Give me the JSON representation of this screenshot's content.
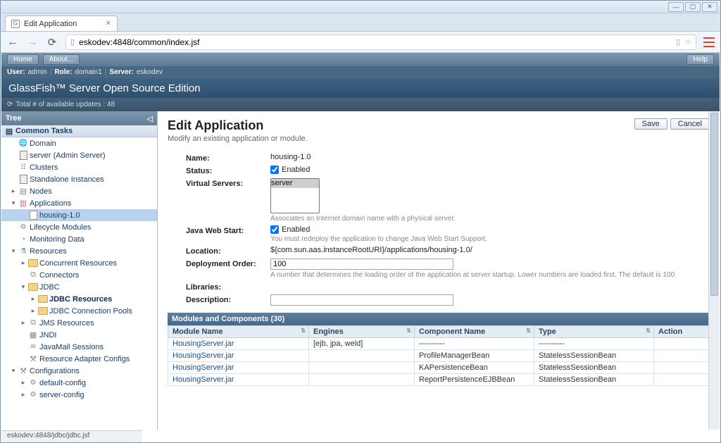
{
  "window": {
    "min": "—",
    "max": "▢",
    "close": "✕"
  },
  "browser": {
    "tab_title": "Edit Application",
    "url": "eskodev:4848/common/index.jsf",
    "status": "eskodev:4848/jdbc/jdbc.jsf"
  },
  "toolbar": {
    "home": "Home",
    "about": "About...",
    "help": "Help"
  },
  "userbar": {
    "user_lbl": "User:",
    "user": "admin",
    "role_lbl": "Role:",
    "role": "domain1",
    "server_lbl": "Server:",
    "server": "eskodev"
  },
  "product_title": "GlassFish™ Server Open Source Edition",
  "updates": {
    "icon": "⟳",
    "text": "Total # of available updates : 48"
  },
  "tree": {
    "header": "Tree",
    "common_tasks": "Common Tasks",
    "items": [
      {
        "ind": 0,
        "exp": "",
        "ico": "ico-globe",
        "txt": "Domain"
      },
      {
        "ind": 0,
        "exp": "",
        "ico": "ico-server",
        "txt": "server (Admin Server)"
      },
      {
        "ind": 0,
        "exp": "",
        "ico": "ico-cluster",
        "txt": "Clusters"
      },
      {
        "ind": 0,
        "exp": "",
        "ico": "ico-server",
        "txt": "Standalone Instances"
      },
      {
        "ind": 0,
        "exp": "▸",
        "ico": "ico-node",
        "txt": "Nodes"
      },
      {
        "ind": 0,
        "exp": "▾",
        "ico": "ico-app",
        "txt": "Applications"
      },
      {
        "ind": 1,
        "exp": "",
        "ico": "ico-doc",
        "txt": "housing-1.0",
        "sel": true
      },
      {
        "ind": 0,
        "exp": "",
        "ico": "ico-gear",
        "txt": "Lifecycle Modules"
      },
      {
        "ind": 0,
        "exp": "",
        "ico": "ico-monitor",
        "txt": "Monitoring Data"
      },
      {
        "ind": 0,
        "exp": "▾",
        "ico": "ico-res",
        "txt": "Resources"
      },
      {
        "ind": 1,
        "exp": "▸",
        "ico": "ico-folder",
        "txt": "Concurrent Resources"
      },
      {
        "ind": 1,
        "exp": "",
        "ico": "ico-conn",
        "txt": "Connectors"
      },
      {
        "ind": 1,
        "exp": "▾",
        "ico": "ico-folder",
        "txt": "JDBC"
      },
      {
        "ind": 2,
        "exp": "▸",
        "ico": "ico-folder",
        "txt": "JDBC Resources",
        "bold": true
      },
      {
        "ind": 2,
        "exp": "▸",
        "ico": "ico-folder",
        "txt": "JDBC Connection Pools"
      },
      {
        "ind": 1,
        "exp": "▸",
        "ico": "ico-conn",
        "txt": "JMS Resources"
      },
      {
        "ind": 1,
        "exp": "",
        "ico": "ico-jndi",
        "txt": "JNDI"
      },
      {
        "ind": 1,
        "exp": "",
        "ico": "ico-mail",
        "txt": "JavaMail Sessions"
      },
      {
        "ind": 1,
        "exp": "",
        "ico": "ico-cfg",
        "txt": "Resource Adapter Configs"
      },
      {
        "ind": 0,
        "exp": "▾",
        "ico": "ico-cfg",
        "txt": "Configurations"
      },
      {
        "ind": 1,
        "exp": "▸",
        "ico": "ico-gear",
        "txt": "default-config"
      },
      {
        "ind": 1,
        "exp": "▸",
        "ico": "ico-gear",
        "txt": "server-config"
      }
    ]
  },
  "page": {
    "title": "Edit Application",
    "subtitle": "Modify an existing application or module.",
    "save": "Save",
    "cancel": "Cancel",
    "name_lbl": "Name:",
    "name_val": "housing-1.0",
    "status_lbl": "Status:",
    "status_val": "Enabled",
    "vs_lbl": "Virtual Servers:",
    "vs_opt": "server",
    "vs_help": "Associates an Internet domain name with a physical server.",
    "jws_lbl": "Java Web Start:",
    "jws_val": "Enabled",
    "jws_help": "You must redeploy the application to change Java Web Start Support.",
    "loc_lbl": "Location:",
    "loc_val": "${com.sun.aas.instanceRootURI}/applications/housing-1.0/",
    "dep_lbl": "Deployment Order:",
    "dep_val": "100",
    "dep_help": "A number that determines the loading order of the application at server startup. Lower numbers are loaded first. The default is 100.",
    "lib_lbl": "Libraries:",
    "desc_lbl": "Description:"
  },
  "table": {
    "title": "Modules and Components (30)",
    "cols": [
      "Module Name",
      "Engines",
      "Component Name",
      "Type",
      "Action"
    ],
    "rows": [
      {
        "m": "HousingServer.jar",
        "e": "[ejb, jpa, weld]",
        "c": "----------",
        "t": "----------"
      },
      {
        "m": "HousingServer.jar",
        "e": "",
        "c": "ProfileManagerBean",
        "t": "StatelessSessionBean"
      },
      {
        "m": "HousingServer.jar",
        "e": "",
        "c": "KAPersistenceBean",
        "t": "StatelessSessionBean"
      },
      {
        "m": "HousingServer.jar",
        "e": "",
        "c": "ReportPersistenceEJBBean",
        "t": "StatelessSessionBean"
      }
    ]
  }
}
